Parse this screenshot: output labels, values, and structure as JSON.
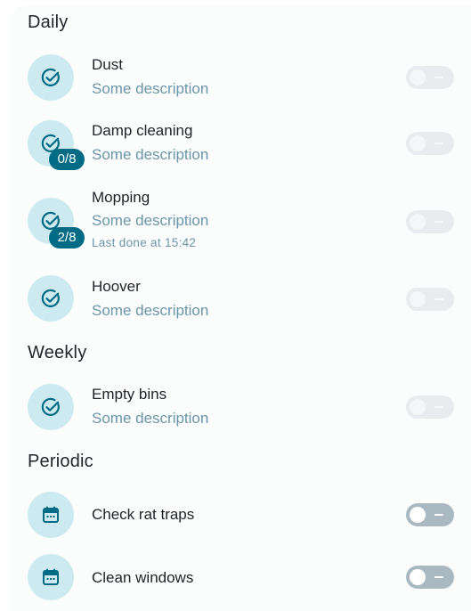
{
  "sections": {
    "daily": {
      "title": "Daily",
      "items": [
        {
          "title": "Dust",
          "description": "Some description",
          "icon": "check-circle-icon",
          "toggle_on": false,
          "enabled": false
        },
        {
          "title": "Damp cleaning",
          "description": "Some description",
          "badge": "0/8",
          "icon": "check-circle-icon",
          "toggle_on": false,
          "enabled": false
        },
        {
          "title": "Mopping",
          "description": "Some description",
          "last_done": "Last done at 15:42",
          "badge": "2/8",
          "icon": "check-circle-icon",
          "toggle_on": false,
          "enabled": false
        },
        {
          "title": "Hoover",
          "description": "Some description",
          "icon": "check-circle-icon",
          "toggle_on": false,
          "enabled": false
        }
      ]
    },
    "weekly": {
      "title": "Weekly",
      "items": [
        {
          "title": "Empty bins",
          "description": "Some description",
          "icon": "check-circle-icon",
          "toggle_on": false,
          "enabled": false
        }
      ]
    },
    "periodic": {
      "title": "Periodic",
      "items": [
        {
          "title": "Check rat traps",
          "icon": "calendar-icon",
          "toggle_on": false,
          "enabled": true
        },
        {
          "title": "Clean windows",
          "icon": "calendar-icon",
          "toggle_on": false,
          "enabled": true
        }
      ]
    }
  },
  "colors": {
    "icon_circle_bg": "#cdeaf0",
    "icon_fg": "#006b84",
    "badge_bg": "#006b84",
    "description_text": "#6b95a8"
  }
}
